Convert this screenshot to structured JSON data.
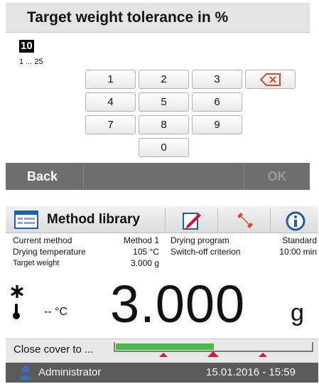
{
  "dialog": {
    "title": "Target weight tolerance  in %",
    "entry_value": "10",
    "range_hint": "1 ... 25",
    "keys": [
      "1",
      "2",
      "3",
      "4",
      "5",
      "6",
      "7",
      "8",
      "9",
      "0"
    ],
    "backspace_icon": "backspace-icon",
    "back_label": "Back",
    "ok_label": "OK"
  },
  "method_screen": {
    "title": "Method library",
    "toolbar_icons": [
      "method-library-icon",
      "edit-icon",
      "wrench-icon",
      "info-icon"
    ],
    "info": {
      "current_method_label": "Current method",
      "current_method_value": "Method 1",
      "drying_temp_label": "Drying temperature",
      "drying_temp_value": "105 °C",
      "target_weight_label": "Target weight",
      "target_weight_value": "3.000 g",
      "drying_program_label": "Drying program",
      "drying_program_value": "Standard",
      "switch_off_label": "Switch-off criterion",
      "switch_off_value": "10:00 min"
    },
    "weight_value": "3.000",
    "weight_unit": "g",
    "temperature_readout": "-- °C",
    "status_text": "Close cover to ...",
    "weighing_progress": 0.5,
    "footer": {
      "user": "Administrator",
      "datetime": "15.01.2016 - 15:59"
    }
  },
  "colors": {
    "progress_green": "#4cb84a",
    "marker_red": "#d6143c",
    "info_blue": "#1f5fa8",
    "footer_bg": "#5a5a5a",
    "button_bar_bg": "#6e6e6e"
  }
}
